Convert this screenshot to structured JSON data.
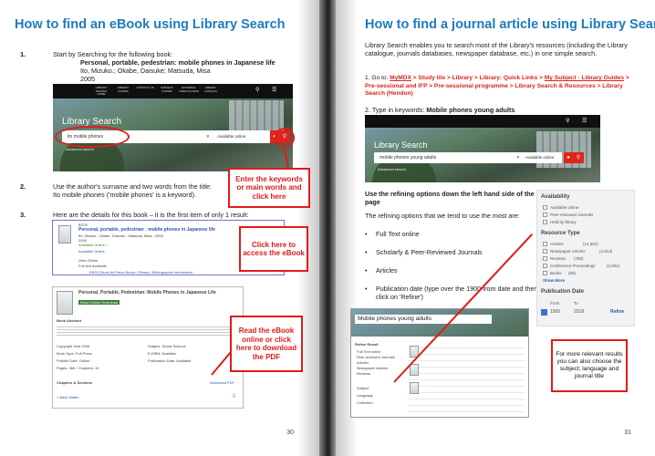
{
  "left": {
    "title": "How to find an eBook using Library Search",
    "step1": {
      "num": "1.",
      "text": "Start by Searching for the following book:",
      "book_title": "Personal, portable, pedestrian: mobile phones in Japanese life",
      "authors": "Ito, Mizuko.; Okabe, Daisuke; Matsuda, Misa",
      "year": "2005"
    },
    "banner": {
      "label": "Library Search",
      "query": "ito mobile phones",
      "scope": "Available online",
      "nav": [
        "LIBRARY SEARCH HOME",
        "LIBRARY GUIDES",
        "CONTACT US",
        "SUBJECT GUIDES",
        "EXTERNAL OPEN ACCESS",
        "LIBRARY CATALOG"
      ],
      "advanced": "Advanced search"
    },
    "callout_keywords": "Enter the keywords or main words and click here",
    "step2": {
      "num": "2.",
      "line1": "Use the author's surname and two words from the title:",
      "line2": "Ito mobile phones ('mobile phones' is a keyword)."
    },
    "step3": {
      "num": "3.",
      "text": "Here are the details for this book – it is the first item of only 1 result:"
    },
    "result": {
      "type": "BOOK",
      "title": "Personal, portable, pedestrian : mobile phones in Japanese life",
      "authors": "Ito, Mizuko ; Okabe, Daisuke ; Matsuda, Misa ; 2005",
      "year": "2005",
      "availability": "Available Online >",
      "link": "Available Online",
      "view_online": "View Online",
      "full_text": "Full text available",
      "footer": "EBSCOhost All Press Books / Ebrary / Bibliographic Information..."
    },
    "callout_access": "Click here to access the eBook",
    "record": {
      "title": "Personal, Portable, Pedestrian: Mobile Phones in Japanese Life",
      "badges": "Read Online  Download",
      "abstract_label": "Book Abstract",
      "rows": [
        [
          "Copyright Year 2005",
          "Subject: Social Science"
        ],
        [
          "Book Type: Full Press",
          "E-ISBN: Available"
        ],
        [
          "Publish Date: Online",
          "Publication Date: Available"
        ],
        [
          "Pages: 366 / Chapters: 14",
          ""
        ]
      ],
      "chapters_label": "Chapters & Sections",
      "download_label": "Download PDF",
      "back": "< Back Matter"
    },
    "callout_read": "Read the eBook online or click here to download the PDF",
    "page_number": "30"
  },
  "right": {
    "title": "How to find a journal article using Library Search",
    "intro": "Library Search enables you to search most of the Library's resources (including the Library catalogue, journals databases, newspaper database, etc.) in one simple search.",
    "step1": {
      "prefix": "1. Go to: ",
      "path_a": "MyMDX",
      "path_b": " > Study tile > Library > Library: Quick Links > ",
      "path_c": "My Subject - Library Guides",
      "path_d": " > Pre-sessional and IFP > Pre-sessional programme > Library Search & Resources > Library Search (Hendon)"
    },
    "step2": {
      "label": "2. Type in keywords: ",
      "keywords": "Mobile phones young adults"
    },
    "banner": {
      "label": "Library Search",
      "query": "mobile phones young adults",
      "scope": "Available online",
      "advanced": "Advanced search"
    },
    "refine_heading": "Use the refining options down the left hand side of the page",
    "refine_intro": "The refining options that we tend to use the most are:",
    "bullets": [
      "Full Text online",
      "Scholarly & Peer-Reviewed Journals",
      "Articles",
      "Publication date (type over the 1900 from date and then click on 'Refine')"
    ],
    "panel": {
      "availability": "Availability",
      "avail_items": [
        "Available online",
        "Peer-reviewed Journals",
        "Held by library"
      ],
      "resource_type": "Resource Type",
      "types": [
        {
          "label": "Articles",
          "count": "(14,301)"
        },
        {
          "label": "Newspaper Articles",
          "count": "(4,913)"
        },
        {
          "label": "Reviews",
          "count": "(780)"
        },
        {
          "label": "Conference Proceedings",
          "count": "(2,001)"
        },
        {
          "label": "Books",
          "count": "(68)"
        }
      ],
      "show_more": "Show More",
      "pub_date": "Publication Date",
      "from_label": "From",
      "to_label": "To",
      "from": "1900",
      "to": "2018",
      "refine": "Refine"
    },
    "mini_screen": {
      "query": "Mobile phones young adults",
      "filter_label": "Refine Result",
      "items": [
        "Full Text online",
        "Peer-reviewed Journals",
        "Articles",
        "Newspaper Articles",
        "Reviews"
      ],
      "subject": "Subject",
      "language": "Language",
      "collection": "Collection"
    },
    "callout_more": "For more relevant results you can also choose the subject; language and journal title",
    "page_number": "31"
  }
}
